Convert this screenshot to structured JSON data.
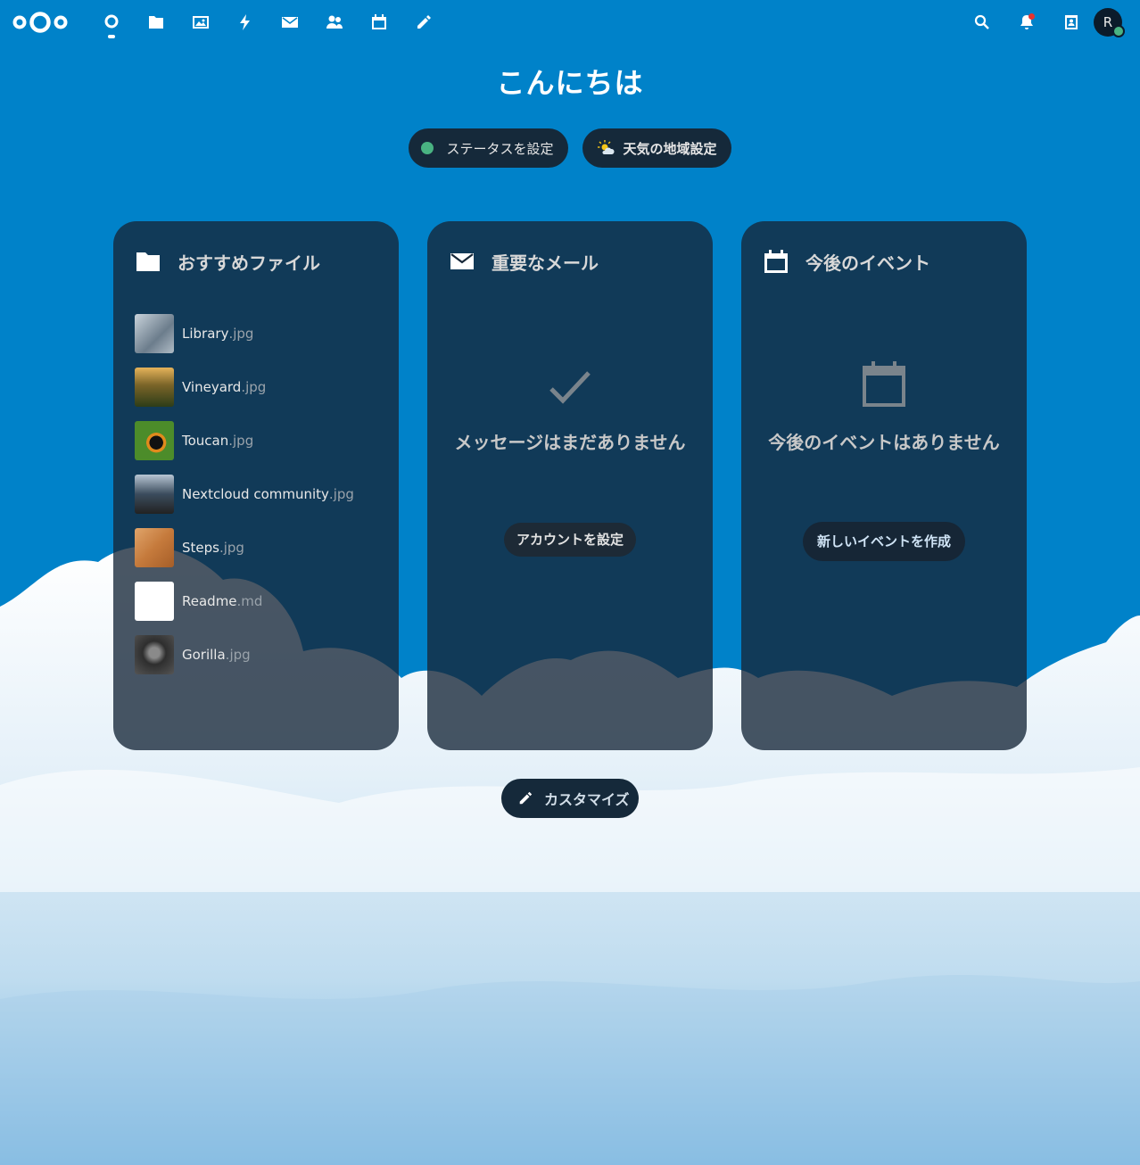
{
  "topbar": {
    "apps": [
      {
        "name": "dashboard",
        "icon": "dashboard-icon",
        "active": true
      },
      {
        "name": "files",
        "icon": "folder-icon"
      },
      {
        "name": "photos",
        "icon": "image-icon"
      },
      {
        "name": "activity",
        "icon": "lightning-icon"
      },
      {
        "name": "mail",
        "icon": "mail-icon"
      },
      {
        "name": "contacts",
        "icon": "contacts-icon"
      },
      {
        "name": "calendar",
        "icon": "calendar-icon"
      },
      {
        "name": "notes",
        "icon": "pencil-icon"
      }
    ],
    "avatar_letter": "R"
  },
  "greeting": "こんにちは",
  "status_button": "ステータスを設定",
  "weather_button": "天気の地域設定",
  "panels": {
    "files": {
      "title": "おすすめファイル",
      "items": [
        {
          "name": "Library",
          "ext": ".jpg",
          "thumb": "#8a9aa8"
        },
        {
          "name": "Vineyard",
          "ext": ".jpg",
          "thumb": "#6b5a2a"
        },
        {
          "name": "Toucan",
          "ext": ".jpg",
          "thumb": "#3f7d2f"
        },
        {
          "name": "Nextcloud community",
          "ext": ".jpg",
          "thumb": "#54677a"
        },
        {
          "name": "Steps",
          "ext": ".jpg",
          "thumb": "#c98a4c"
        },
        {
          "name": "Readme",
          "ext": ".md",
          "thumb": "#ffffff"
        },
        {
          "name": "Gorilla",
          "ext": ".jpg",
          "thumb": "#4a4a4a"
        }
      ]
    },
    "mail": {
      "title": "重要なメール",
      "empty_text": "メッセージはまだありません",
      "button": "アカウントを設定"
    },
    "events": {
      "title": "今後のイベント",
      "empty_text": "今後のイベントはありません",
      "button": "新しいイベントを作成"
    }
  },
  "customize_button": "カスタマイズ",
  "colors": {
    "background": "#0082c9",
    "panel": "#162738",
    "status_online": "#49b382"
  }
}
